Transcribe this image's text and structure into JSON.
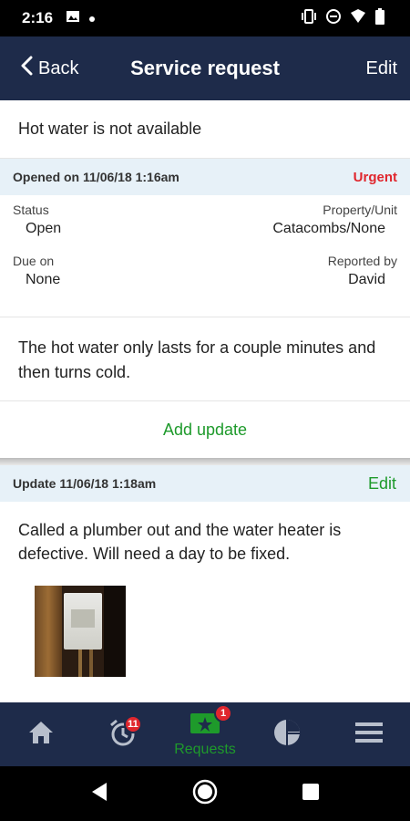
{
  "status_bar": {
    "time": "2:16"
  },
  "app_bar": {
    "back_label": "Back",
    "title": "Service request",
    "edit_label": "Edit"
  },
  "request": {
    "title": "Hot water is not available",
    "opened": "Opened on 11/06/18 1:16am",
    "priority": "Urgent",
    "status_label": "Status",
    "status_value": "Open",
    "property_label": "Property/Unit",
    "property_value": "Catacombs/None",
    "due_label": "Due on",
    "due_value": "None",
    "reported_label": "Reported by",
    "reported_value": "David",
    "description": "The hot water only lasts for a couple minutes and then turns cold.",
    "add_update_label": "Add update"
  },
  "update": {
    "header": "Update 11/06/18 1:18am",
    "edit_label": "Edit",
    "text": "Called a plumber out and the water heater is defective. Will need a day to be fixed.",
    "photo_icon": "water-heater-photo"
  },
  "tabs": [
    {
      "name": "home",
      "icon": "home-icon"
    },
    {
      "name": "reminders",
      "icon": "alarm-clock-icon",
      "badge": "11"
    },
    {
      "name": "requests",
      "icon": "requests-icon",
      "label": "Requests",
      "badge": "1",
      "active": true
    },
    {
      "name": "reports",
      "icon": "pie-chart-icon"
    },
    {
      "name": "menu",
      "icon": "hamburger-menu-icon"
    }
  ],
  "colors": {
    "app_bar": "#1e2b4a",
    "accent_green": "#1e9a2b",
    "urgent_red": "#e0262d",
    "section_header_bg": "#e7f1f8"
  }
}
